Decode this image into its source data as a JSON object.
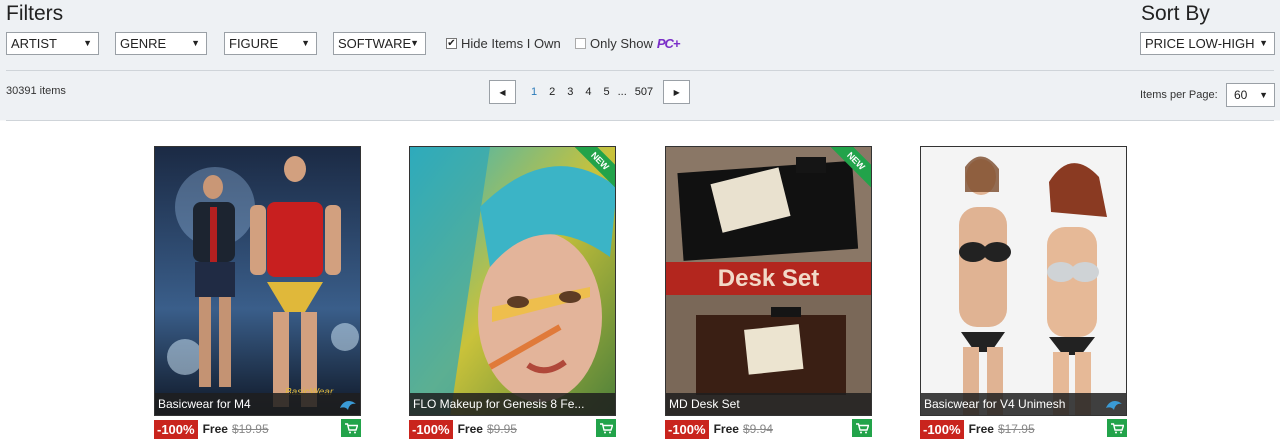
{
  "filters": {
    "title": "Filters",
    "dropdowns": [
      {
        "label": "ARTIST"
      },
      {
        "label": "GENRE"
      },
      {
        "label": "FIGURE"
      },
      {
        "label": "SOFTWARE"
      }
    ],
    "hide_owned": {
      "label": "Hide Items I Own",
      "checked": true
    },
    "only_show": {
      "label": "Only Show",
      "badge": "PC+",
      "checked": false
    }
  },
  "sort": {
    "title": "Sort By",
    "selected": "PRICE LOW-HIGH"
  },
  "results": {
    "count_text": "30391 items",
    "pages": [
      "1",
      "2",
      "3",
      "4",
      "5"
    ],
    "ellipsis": "...",
    "last_page": "507",
    "current_page": "1",
    "items_per_page_label": "Items per Page:",
    "items_per_page": "60"
  },
  "products": [
    {
      "title": "Basicwear for M4",
      "discount": "-100%",
      "price": "Free",
      "old_price": "$19.95",
      "new": false,
      "icon": "daz-dragon-icon"
    },
    {
      "title": "FLO Makeup for Genesis 8 Fe...",
      "discount": "-100%",
      "price": "Free",
      "old_price": "$9.95",
      "new": true,
      "new_label": "NEW"
    },
    {
      "title": "MD Desk Set",
      "discount": "-100%",
      "price": "Free",
      "old_price": "$9.94",
      "new": true,
      "new_label": "NEW",
      "banner_text": "Desk Set"
    },
    {
      "title": "Basicwear for V4 Unimesh",
      "discount": "-100%",
      "price": "Free",
      "old_price": "$17.95",
      "new": false,
      "icon": "daz-dragon-icon"
    }
  ],
  "colors": {
    "accent_green": "#22a34a",
    "discount_red": "#c9241d",
    "current_page_blue": "#2b7bb9",
    "pc_plus_purple": "#7b2fc8"
  }
}
